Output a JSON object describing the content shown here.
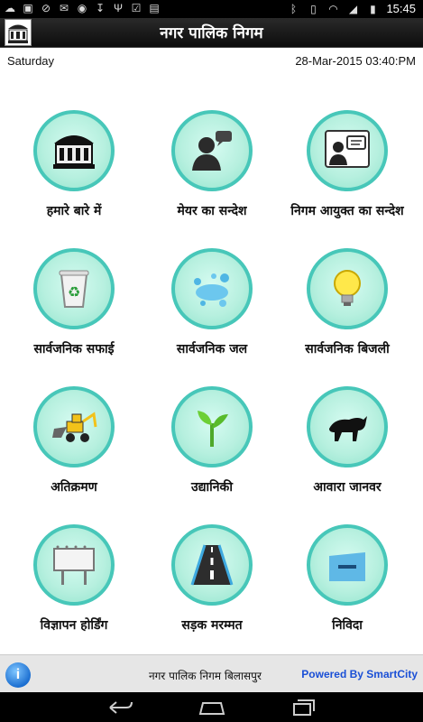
{
  "status_bar": {
    "time": "15:45",
    "left_icons": [
      "cloud-upload-icon",
      "image-icon",
      "no-sim-icon",
      "mail-icon",
      "eye-icon",
      "download-icon",
      "usb-icon",
      "checklist-icon",
      "lock-icon"
    ],
    "right_icons": [
      "bluetooth-icon",
      "vibrate-icon",
      "wifi-icon",
      "signal-icon",
      "battery-icon"
    ]
  },
  "header": {
    "title": "नगर पालिक निगम"
  },
  "date_row": {
    "day": "Saturday",
    "datetime": "28-Mar-2015 03:40:PM"
  },
  "tiles": [
    {
      "label": "हमारे बारे में",
      "icon": "building-icon"
    },
    {
      "label": "मेयर का सन्देश",
      "icon": "person-message-icon"
    },
    {
      "label": "निगम आयुक्त का सन्देश",
      "icon": "commissioner-message-icon"
    },
    {
      "label": "सार्वजनिक सफाई",
      "icon": "recycle-bin-icon"
    },
    {
      "label": "सार्वजनिक जल",
      "icon": "water-splash-icon"
    },
    {
      "label": "सार्वजनिक बिजली",
      "icon": "bulb-icon"
    },
    {
      "label": "अतिक्रमण",
      "icon": "bulldozer-icon"
    },
    {
      "label": "उद्यानिकी",
      "icon": "plant-icon"
    },
    {
      "label": "आवारा जानवर",
      "icon": "bull-icon"
    },
    {
      "label": "विज्ञापन होर्डिंग",
      "icon": "billboard-icon"
    },
    {
      "label": "सड़क मरम्मत",
      "icon": "road-icon"
    },
    {
      "label": "निविदा",
      "icon": "tender-box-icon"
    }
  ],
  "footer": {
    "info_icon_text": "i",
    "org_name": "नगर पालिक निगम बिलासपुर",
    "powered_by": "Powered By SmartCity"
  },
  "nav_bar": [
    "back-icon",
    "home-icon",
    "recents-icon"
  ]
}
